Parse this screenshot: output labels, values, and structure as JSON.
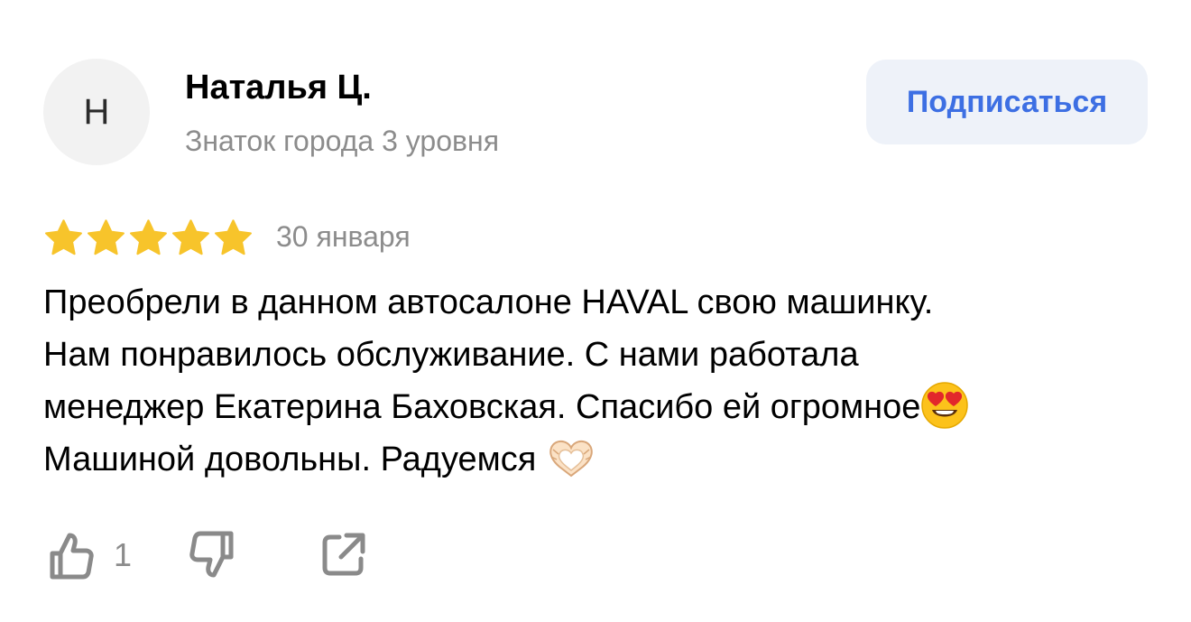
{
  "author": {
    "avatar_initial": "Н",
    "name": "Наталья Ц.",
    "level": "Знаток города 3 уровня"
  },
  "subscribe": {
    "label": "Подписаться"
  },
  "rating": {
    "stars": 5,
    "max": 5,
    "date": "30 января",
    "star_color": "#f7c42b"
  },
  "review": {
    "lines": [
      "Преобрели в данном автосалоне HAVAL свою машинку.",
      "Нам понравилось обслуживание. С нами работала",
      "менеджер Екатерина Баховская. Спасибо ей огромное",
      "Машиной довольны. Радуемся "
    ],
    "emoji": [
      "heart-eyes-emoji",
      "heart-hands-emoji"
    ]
  },
  "actions": {
    "like_count": "1",
    "icons": [
      "thumbs-up-icon",
      "thumbs-down-icon",
      "share-icon"
    ]
  },
  "colors": {
    "accent": "#3d6fe3",
    "muted_text": "#8c8c8c",
    "button_bg": "#eef2f9",
    "icon_color": "#8a8a8a"
  }
}
